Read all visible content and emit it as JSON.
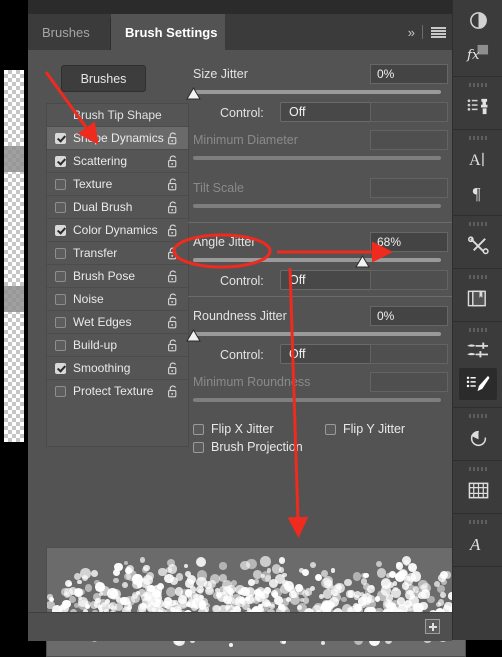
{
  "app": {
    "panel_title": "Brush Settings",
    "accent_annotation_color": "#ef2a1e",
    "panel_bg": "#535353"
  },
  "tabs": [
    {
      "label": "Brushes",
      "active": false
    },
    {
      "label": "Brush Settings",
      "active": true
    }
  ],
  "tabbar": {
    "more_icon": "chevron-double-right-icon",
    "more_glyph": "»",
    "menu_icon": "panel-menu-icon"
  },
  "toolbar": {
    "brushes_button": "Brushes"
  },
  "brush_list": {
    "header": "Brush Tip Shape",
    "items": [
      {
        "label": "Shape Dynamics",
        "checked": true,
        "selected": true,
        "locked": false
      },
      {
        "label": "Scattering",
        "checked": true,
        "selected": false,
        "locked": false
      },
      {
        "label": "Texture",
        "checked": false,
        "selected": false,
        "locked": false
      },
      {
        "label": "Dual Brush",
        "checked": false,
        "selected": false,
        "locked": false
      },
      {
        "label": "Color Dynamics",
        "checked": true,
        "selected": false,
        "locked": false
      },
      {
        "label": "Transfer",
        "checked": false,
        "selected": false,
        "locked": false
      },
      {
        "label": "Brush Pose",
        "checked": false,
        "selected": false,
        "locked": false
      },
      {
        "label": "Noise",
        "checked": false,
        "selected": false,
        "locked": false
      },
      {
        "label": "Wet Edges",
        "checked": false,
        "selected": false,
        "locked": false
      },
      {
        "label": "Build-up",
        "checked": false,
        "selected": false,
        "locked": false
      },
      {
        "label": "Smoothing",
        "checked": true,
        "selected": false,
        "locked": false
      },
      {
        "label": "Protect Texture",
        "checked": false,
        "selected": false,
        "locked": false
      }
    ]
  },
  "settings": {
    "size_jitter": {
      "label": "Size Jitter",
      "value": "0%",
      "slider_pct": 0,
      "dim": false
    },
    "size_control": {
      "label": "Control:",
      "value": "Off",
      "extra": ""
    },
    "minimum_diameter": {
      "label": "Minimum Diameter",
      "value": "",
      "slider_pct": 0,
      "dim": true
    },
    "tilt_scale": {
      "label": "Tilt Scale",
      "value": "",
      "slider_pct": 0,
      "dim": true
    },
    "angle_jitter": {
      "label": "Angle Jitter",
      "value": "68%",
      "slider_pct": 68,
      "dim": false
    },
    "angle_control": {
      "label": "Control:",
      "value": "Off",
      "extra": ""
    },
    "roundness_jitter": {
      "label": "Roundness Jitter",
      "value": "0%",
      "slider_pct": 0,
      "dim": false
    },
    "roundness_control": {
      "label": "Control:",
      "value": "Off",
      "extra": ""
    },
    "minimum_roundness": {
      "label": "Minimum Roundness",
      "value": "",
      "slider_pct": 0,
      "dim": true
    },
    "flip_x": {
      "label": "Flip X Jitter",
      "checked": false
    },
    "flip_y": {
      "label": "Flip Y Jitter",
      "checked": false
    },
    "brush_projection": {
      "label": "Brush Projection",
      "checked": false
    }
  },
  "footer": {
    "new_brush_icon": "new-brush-icon"
  },
  "rail": {
    "groups": [
      {
        "grip": false,
        "icons": [
          {
            "name": "adjustments-icon"
          },
          {
            "name": "layer-effects-fx-icon"
          }
        ]
      },
      {
        "grip": true,
        "icons": [
          {
            "name": "clone-source-icon"
          }
        ]
      },
      {
        "grip": true,
        "icons": [
          {
            "name": "character-icon"
          },
          {
            "name": "paragraph-icon"
          }
        ]
      },
      {
        "grip": true,
        "icons": [
          {
            "name": "tool-presets-icon"
          }
        ]
      },
      {
        "grip": true,
        "icons": [
          {
            "name": "libraries-icon"
          }
        ]
      },
      {
        "grip": true,
        "icons": [
          {
            "name": "brushes-icon"
          },
          {
            "name": "brush-settings-icon",
            "active": true
          }
        ]
      },
      {
        "grip": true,
        "icons": [
          {
            "name": "history-icon"
          }
        ]
      },
      {
        "grip": true,
        "icons": [
          {
            "name": "properties-icon"
          }
        ]
      },
      {
        "grip": true,
        "icons": [
          {
            "name": "glyphs-icon"
          }
        ]
      }
    ]
  },
  "annotations": {
    "arrow_to_shape_dynamics": "red arrow pointing to Shape Dynamics",
    "ellipse_angle_jitter": "red ellipse around Angle Jitter label",
    "arrow_to_value": "red arrow pointing to 68% field",
    "arrow_to_preview": "red arrow pointing down to stroke preview"
  },
  "preview": {
    "description": "scattered white dot brush stroke preview"
  }
}
